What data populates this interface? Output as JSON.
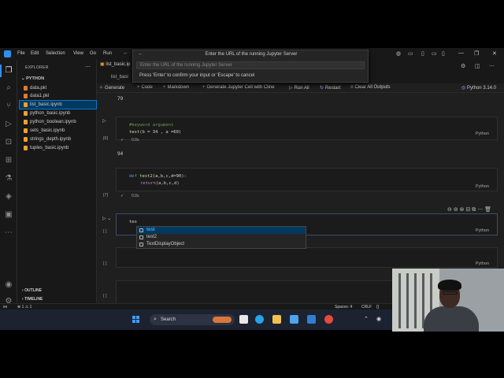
{
  "titlebar": {
    "menus": [
      "File",
      "Edit",
      "Selection",
      "View",
      "Go",
      "Run"
    ]
  },
  "quickpick": {
    "title": "Enter the URL of the running Jupyter Server",
    "placeholder": "Enter the URL of the running Jupyter Server",
    "message": "Press 'Enter' to confirm your input or 'Escape' to cancel"
  },
  "sidebar": {
    "header": "EXPLORER",
    "folder": "PYTHON",
    "files": [
      {
        "name": "data.pkl",
        "selected": false
      },
      {
        "name": "data1.pkl",
        "selected": false
      },
      {
        "name": "list_basic.ipynb",
        "selected": true
      },
      {
        "name": "python_basic.ipynb",
        "selected": false
      },
      {
        "name": "python_boolean.ipynb",
        "selected": false
      },
      {
        "name": "sets_basic.ipynb",
        "selected": false
      },
      {
        "name": "strings_depth.ipynb",
        "selected": false
      },
      {
        "name": "tuples_basic.ipynb",
        "selected": false
      }
    ],
    "outline": "OUTLINE",
    "timeline": "TIMELINE"
  },
  "tabs": {
    "active": "list_basic.ip",
    "breadcrumb": "list_basi"
  },
  "toolbar": {
    "generate": "Generate",
    "code": "Code",
    "markdown": "Markdown",
    "cline": "Generate Jupyter Cell with Cline",
    "run_all": "Run All",
    "restart": "Restart",
    "clear": "Clear All Outputs",
    "kernel": "Python 3.14.0"
  },
  "cells": [
    {
      "output_top": "79"
    },
    {
      "exec": "[6]",
      "line1": "#keyword argument",
      "line2_fn": "test",
      "line2_rest": "(b = 34 , a =60)",
      "status": "✓",
      "time": "0.0s",
      "lang": "Python",
      "output": "94"
    },
    {
      "exec": "[7]",
      "line1_def": "def",
      "line1_fn": " test2",
      "line1_rest": "(a,b,c,d=90):",
      "line2_ret": "return",
      "line2_rest": "(a,b,c,d)",
      "status": "✓",
      "time": "0.0s",
      "lang": "Python"
    },
    {
      "exec": "[ ]",
      "typed": "tes",
      "lang": "Python"
    },
    {
      "exec": "[ ]",
      "lang": "Python"
    },
    {
      "exec": "[ ]"
    }
  ],
  "suggestions": [
    {
      "label": "test",
      "match": "tes",
      "rest": "t",
      "selected": true
    },
    {
      "label": "test2",
      "match": "",
      "rest": "test2",
      "selected": false
    },
    {
      "label": "TextDisplayObject",
      "match": "",
      "rest": "TextDisplayObject",
      "selected": false
    }
  ],
  "statusbar": {
    "left": "⊗ 1  ⚠ 1",
    "spaces": "Spaces: 4",
    "eol": "CRLF"
  },
  "taskbar": {
    "search": "Search"
  },
  "colors": {
    "accent": "#0078d4",
    "background": "#1f1f1f",
    "sidebar": "#181818"
  }
}
